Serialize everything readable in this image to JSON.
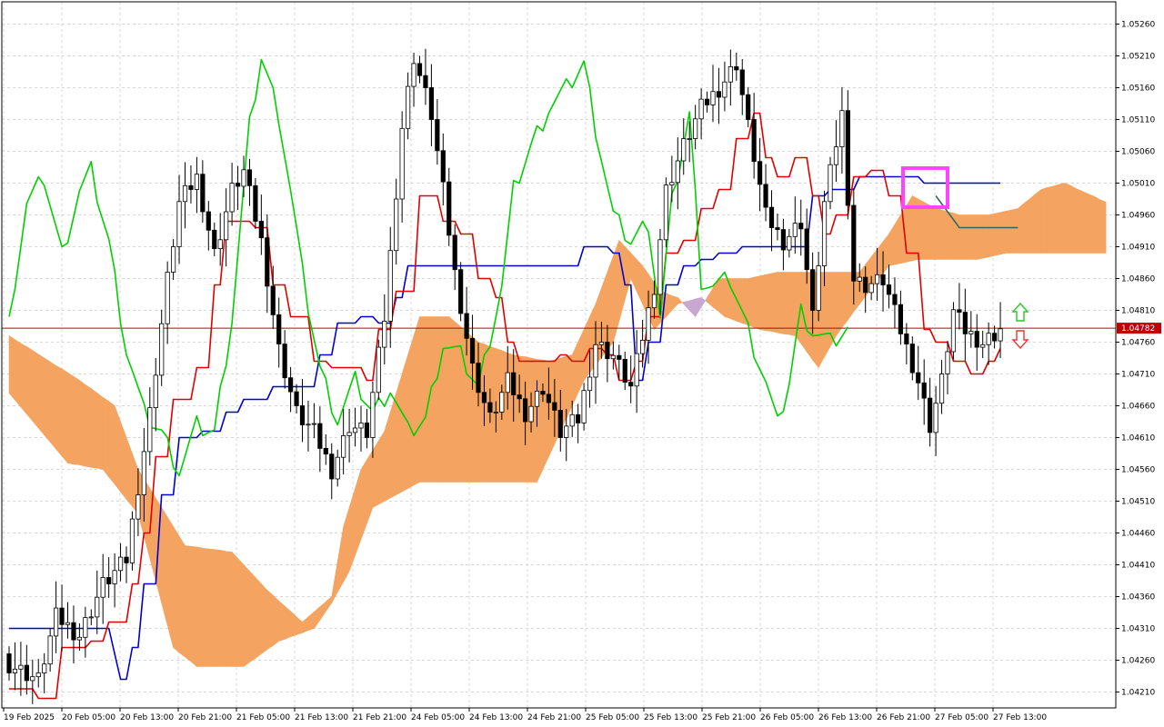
{
  "chart_data": {
    "type": "candlestick",
    "title": "",
    "grid": true,
    "y_ticks": [
      "1.05260",
      "1.05210",
      "1.05160",
      "1.05110",
      "1.05060",
      "1.05010",
      "1.04960",
      "1.04910",
      "1.04860",
      "1.04810",
      "1.04760",
      "1.04710",
      "1.04660",
      "1.04610",
      "1.04560",
      "1.04510",
      "1.04460",
      "1.04410",
      "1.04360",
      "1.04310",
      "1.04260",
      "1.04210"
    ],
    "x_ticks": [
      "19 Feb 2025",
      "20 Feb 05:00",
      "20 Feb 13:00",
      "20 Feb 21:00",
      "21 Feb 05:00",
      "21 Feb 13:00",
      "21 Feb 21:00",
      "24 Feb 05:00",
      "24 Feb 13:00",
      "24 Feb 21:00",
      "25 Feb 05:00",
      "25 Feb 13:00",
      "25 Feb 21:00",
      "26 Feb 05:00",
      "26 Feb 13:00",
      "26 Feb 21:00",
      "27 Feb 05:00",
      "27 Feb 13:00"
    ],
    "current_price": "1.04782",
    "ylim": [
      1.04185,
      1.05295
    ],
    "colors": {
      "tenkan": "#e00000",
      "kijun": "#0000d0",
      "chikou": "#00d000",
      "cloud_bull": "#f4a460",
      "cloud_bear": "#c8a8d0",
      "price_line": "#c00000",
      "price_label_bg": "#c00000",
      "highlight_box": "#ff44ff",
      "arrow_up": "#22cc22",
      "arrow_down": "#ee3333",
      "projection": "#2e6b5a"
    },
    "candles": [],
    "tenkan": [],
    "kijun": [],
    "chikou": [],
    "span_a": [],
    "span_b": []
  }
}
